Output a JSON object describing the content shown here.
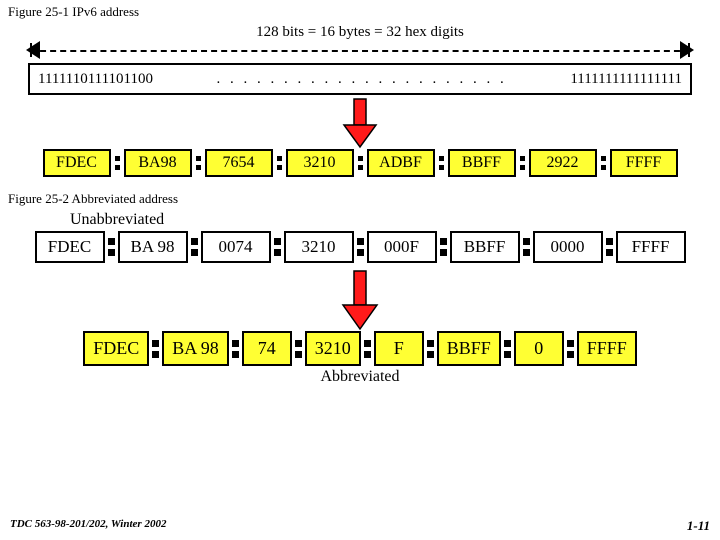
{
  "fig1": {
    "caption": "Figure  25-1  IPv6 address"
  },
  "dim": {
    "label": "128 bits = 16 bytes = 32 hex digits"
  },
  "bin": {
    "left": "1111110111101100",
    "mid": ". . . . . . . . . . . . . . . . . . . . . .",
    "right": "1111111111111111"
  },
  "hex1": [
    "FDEC",
    "BA98",
    "7654",
    "3210",
    "ADBF",
    "BBFF",
    "2922",
    "FFFF"
  ],
  "fig2": {
    "caption": "Figure  25-2  Abbreviated address"
  },
  "labels": {
    "unabbr": "Unabbreviated",
    "abbr": "Abbreviated"
  },
  "hex2": [
    "FDEC",
    "BA 98",
    "0074",
    "3210",
    "000F",
    "BBFF",
    "0000",
    "FFFF"
  ],
  "hex3": [
    "FDEC",
    "BA 98",
    "74",
    "3210",
    "F",
    "BBFF",
    "0",
    "FFFF"
  ],
  "footer": {
    "left": "TDC 563-98-201/202, Winter 2002",
    "right": "1-11"
  }
}
